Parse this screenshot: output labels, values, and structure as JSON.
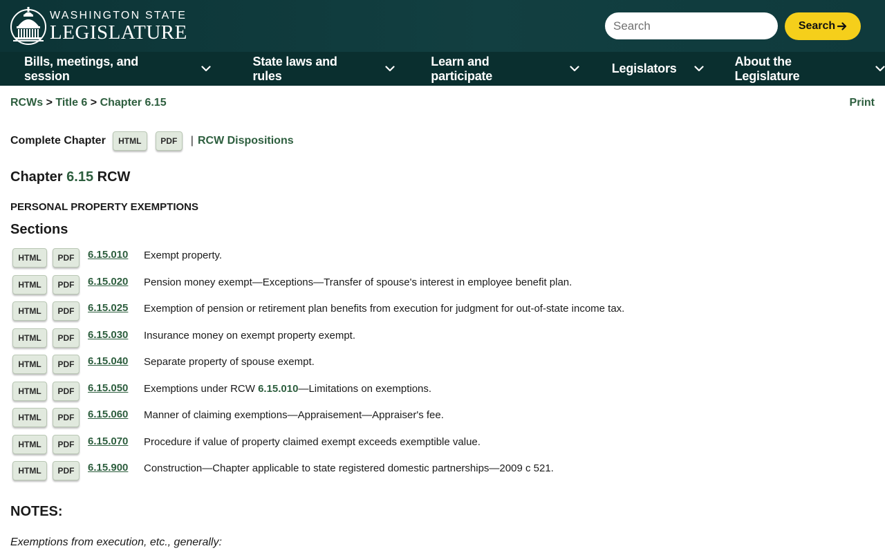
{
  "header": {
    "logo_line1": "WASHINGTON STATE",
    "logo_line2": "LEGISLATURE",
    "search_placeholder": "Search",
    "search_button": "Search"
  },
  "nav": [
    {
      "label": "Bills, meetings, and session"
    },
    {
      "label": "State laws and rules"
    },
    {
      "label": "Learn and participate"
    },
    {
      "label": "Legislators"
    },
    {
      "label": "About the Legislature"
    }
  ],
  "breadcrumb": {
    "items": [
      "RCWs",
      "Title 6",
      "Chapter 6.15"
    ],
    "separator": ">"
  },
  "print_label": "Print",
  "complete_chapter": {
    "label": "Complete Chapter",
    "html": "HTML",
    "pdf": "PDF",
    "separator": "|",
    "dispositions": "RCW Dispositions"
  },
  "chapter": {
    "prefix": "Chapter",
    "number": "6.15",
    "suffix": "RCW",
    "title": "PERSONAL PROPERTY EXEMPTIONS"
  },
  "sections_heading": "Sections",
  "sections": [
    {
      "num": "6.15.010",
      "caption": "Exempt property."
    },
    {
      "num": "6.15.020",
      "caption": "Pension money exempt—Exceptions—Transfer of spouse's interest in employee benefit plan."
    },
    {
      "num": "6.15.025",
      "caption": "Exemption of pension or retirement plan benefits from execution for judgment for out-of-state income tax."
    },
    {
      "num": "6.15.030",
      "caption": "Insurance money on exempt property exempt."
    },
    {
      "num": "6.15.040",
      "caption": "Separate property of spouse exempt."
    },
    {
      "num": "6.15.050",
      "caption_pre": "Exemptions under RCW ",
      "caption_link": "6.15.010",
      "caption_post": "—Limitations on exemptions."
    },
    {
      "num": "6.15.060",
      "caption": "Manner of claiming exemptions—Appraisement—Appraiser's fee."
    },
    {
      "num": "6.15.070",
      "caption": "Procedure if value of property claimed exempt exceeds exemptible value."
    },
    {
      "num": "6.15.900",
      "caption": "Construction—Chapter applicable to state registered domestic partnerships—2009 c 521."
    }
  ],
  "badge_html": "HTML",
  "badge_pdf": "PDF",
  "notes_heading": "NOTES:",
  "notes_text": "Exemptions from execution, etc., generally:",
  "colors": {
    "header_bg": "#123f41",
    "nav_bg": "#0a2f2f",
    "accent_yellow": "#f5cf1b",
    "link_green": "#2d5e3e",
    "badge_bg": "#e1e9de"
  }
}
